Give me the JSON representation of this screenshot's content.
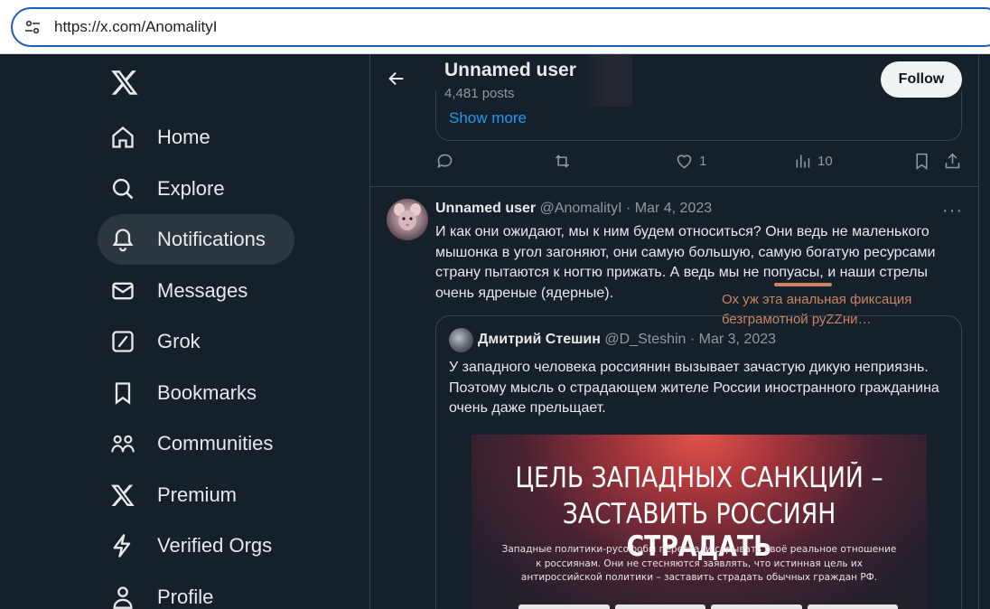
{
  "browser": {
    "url": "https://x.com/AnomalityI"
  },
  "sidebar": {
    "items": [
      {
        "label": "Home",
        "icon": "home-icon"
      },
      {
        "label": "Explore",
        "icon": "search-icon"
      },
      {
        "label": "Notifications",
        "icon": "bell-icon",
        "active": true
      },
      {
        "label": "Messages",
        "icon": "envelope-icon"
      },
      {
        "label": "Grok",
        "icon": "grok-icon"
      },
      {
        "label": "Bookmarks",
        "icon": "bookmark-icon"
      },
      {
        "label": "Communities",
        "icon": "people-icon"
      },
      {
        "label": "Premium",
        "icon": "x-icon"
      },
      {
        "label": "Verified Orgs",
        "icon": "lightning-icon"
      },
      {
        "label": "Profile",
        "icon": "person-icon"
      }
    ]
  },
  "header": {
    "name": "Unnamed user",
    "posts": "4,481 posts",
    "follow_label": "Follow"
  },
  "prev_post": {
    "show_more": "Show more",
    "likes": "1",
    "views": "10"
  },
  "tweet": {
    "name": "Unnamed user",
    "meta": "@AnomalityI · Mar 4, 2023",
    "more": "···",
    "text_before": "И как они ожидают, мы к ним будем относиться? Они ведь не маленького мышонка в угол загоняют, они самую большую, самую богатую ресурсами страну пытаются к ногтю прижать. А ведь мы не ",
    "text_highlight": "попуасы",
    "text_after": ", и наши стрелы очень ядреные (ядерные)."
  },
  "annotation": {
    "line1": "Ох уж эта анальная фиксация",
    "line2": "безграмотной руZZни…"
  },
  "quote": {
    "name": "Дмитрий Стешин",
    "meta": "@D_Steshin · Mar 3, 2023",
    "text": "У западного человека россиянин вызывает зачастую дикую неприязнь. Поэтому мысль о страдающем жителе России иностранного гражданина очень даже прельщает.",
    "image": {
      "line1": "ЦЕЛЬ ЗАПАДНЫХ САНКЦИЙ –",
      "line2_normal": "ЗАСТАВИТЬ РОССИЯН ",
      "line2_bold": "СТРАДАТЬ",
      "small": "Западные политики-русофобы перестали скрывать своё реальное отношение к россиянам. Они не стесняются заявлять, что истинная цель их антироссийской политики – заставить страдать обычных граждан РФ."
    }
  },
  "colors": {
    "background": "#15202b",
    "accent": "#1d9bf0",
    "annotation": "#c98461"
  }
}
